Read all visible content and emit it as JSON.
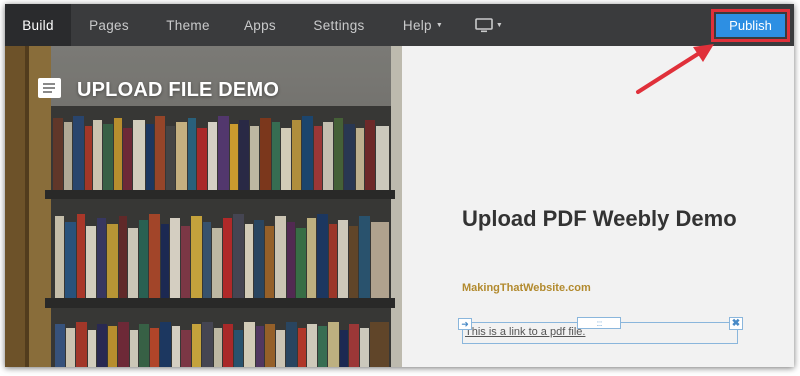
{
  "nav": {
    "items": [
      {
        "label": "Build",
        "active": true
      },
      {
        "label": "Pages"
      },
      {
        "label": "Theme"
      },
      {
        "label": "Apps"
      },
      {
        "label": "Settings"
      },
      {
        "label": "Help"
      }
    ],
    "publish_label": "Publish"
  },
  "hero": {
    "title": "UPLOAD FILE DEMO"
  },
  "content": {
    "title": "Upload PDF Weebly Demo",
    "site_link": "MakingThatWebsite.com",
    "pdf_link_text": "This is a link to a pdf file.",
    "drag_handle_glyph": "::::",
    "close_glyph": "✖",
    "left_handle_glyph": "➜"
  },
  "colors": {
    "topbar": "#3a3b3d",
    "publish": "#2d8fe3",
    "highlight": "#e0303a",
    "site_link": "#b28a2e"
  },
  "icons": [
    "text-block-icon",
    "desktop-icon",
    "chevron-down-icon",
    "close-icon",
    "arrow-right-icon"
  ]
}
